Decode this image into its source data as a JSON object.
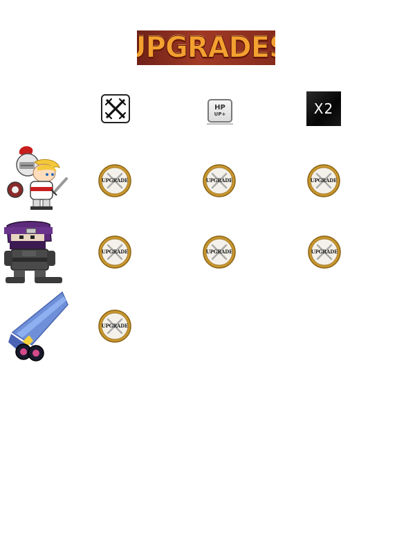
{
  "title": "UPGRADES",
  "stat_columns": [
    {
      "name": "attack",
      "icon": "crossed-swords-icon"
    },
    {
      "name": "health",
      "icon": "hp-up-icon",
      "line1": "HP",
      "line2": "UP+"
    },
    {
      "name": "multiplier",
      "icon": "x2-icon",
      "label": "X2"
    }
  ],
  "units": [
    {
      "name": "knight",
      "icon": "knight-icon"
    },
    {
      "name": "ninja",
      "icon": "ninja-icon"
    },
    {
      "name": "cannon",
      "icon": "cannon-icon"
    }
  ],
  "upgrade_label": "UPGRADE",
  "colors": {
    "coin_gold": "#c9962e",
    "title_red": "#8f2f20",
    "title_text": "#f3a030"
  }
}
